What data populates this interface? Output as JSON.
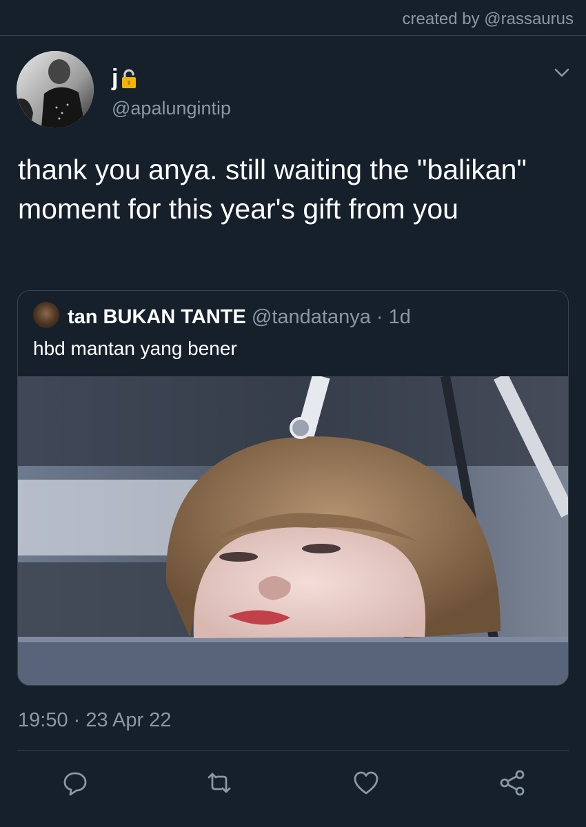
{
  "credit": "created by @rassaurus",
  "author": {
    "display_name": "j",
    "handle": "@apalungintip"
  },
  "tweet": {
    "text": "thank you anya. still waiting the \"balikan\" moment for this year's gift from you",
    "timestamp": "19:50 · 23 Apr 22"
  },
  "quoted": {
    "name": "tan BUKAN TANTE",
    "handle": "@tandatanya",
    "age": "· 1d",
    "text": "hbd mantan yang bener"
  },
  "icons": {
    "lock": "lock-icon",
    "menu": "chevron-down-icon",
    "reply": "reply-icon",
    "retweet": "retweet-icon",
    "like": "heart-icon",
    "share": "share-icon"
  },
  "colors": {
    "background": "#15202b",
    "muted": "#8899a6",
    "border": "#38444d",
    "lock": "#f4b400"
  }
}
